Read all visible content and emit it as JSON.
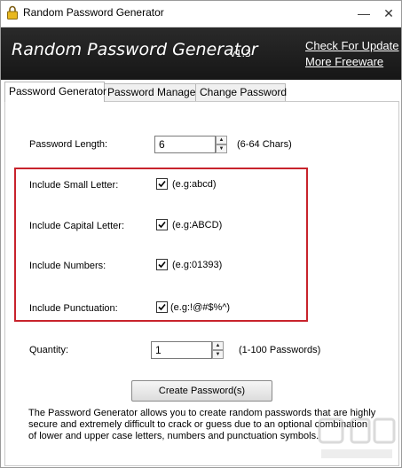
{
  "window": {
    "title": "Random Password Generator",
    "minimize_label": "—",
    "close_label": "✕"
  },
  "banner": {
    "app_name": "Random Password Generator",
    "version": "v1.3",
    "link_update": "Check For Update",
    "link_freeware": "More Freeware"
  },
  "tabs": [
    {
      "label": "Password Generator",
      "active": true
    },
    {
      "label": "Password Manager",
      "active": false
    },
    {
      "label": "Change Password",
      "active": false
    }
  ],
  "form": {
    "length_label": "Password Length:",
    "length_value": "6",
    "length_hint": "(6-64 Chars)",
    "options": [
      {
        "label": "Include Small Letter:",
        "checked": true,
        "example": "(e.g:abcd)"
      },
      {
        "label": "Include Capital Letter:",
        "checked": true,
        "example": "(e.g:ABCD)"
      },
      {
        "label": "Include Numbers:",
        "checked": true,
        "example": "(e.g:01393)"
      },
      {
        "label": "Include Punctuation:",
        "checked": true,
        "example": "(e.g:!@#$%^)"
      }
    ],
    "quantity_label": "Quantity:",
    "quantity_value": "1",
    "quantity_hint": "(1-100 Passwords)",
    "create_button": "Create Password(s)"
  },
  "description": "The Password Generator allows you to create random passwords that are highly secure and extremely difficult to crack or guess due to an optional combination of lower and upper case letters, numbers and punctuation symbols.",
  "colors": {
    "banner_bg": "#1f1f1f",
    "highlight_border": "#c8232c"
  }
}
